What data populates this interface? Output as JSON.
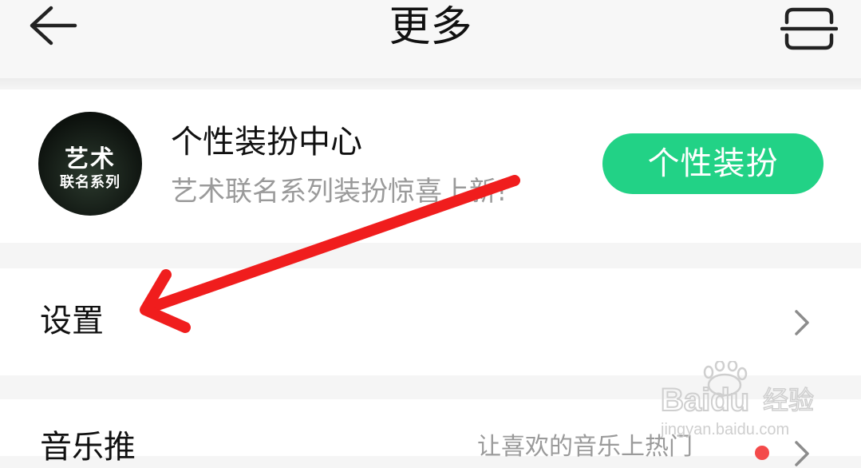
{
  "header": {
    "title": "更多",
    "back_icon": "arrow-left-icon",
    "scan_icon": "scan-icon"
  },
  "skin_center": {
    "avatar_line1": "艺术",
    "avatar_line2": "联名系列",
    "title": "个性装扮中心",
    "subtitle": "艺术联名系列装扮惊喜上新!",
    "button_label": "个性装扮",
    "button_color": "#22d286"
  },
  "settings": {
    "label": "设置",
    "chevron_icon": "chevron-right-icon"
  },
  "music_promo": {
    "label": "音乐推",
    "hint": "让喜欢的音乐上热门",
    "dot_color": "#f44a4a"
  },
  "annotation": {
    "arrow_color": "#f01d1d",
    "arrow_icon": "red-arrow-annotation"
  },
  "watermark": {
    "brand": "Baidu",
    "text": "经验",
    "url": "jingyan.baidu.com"
  }
}
